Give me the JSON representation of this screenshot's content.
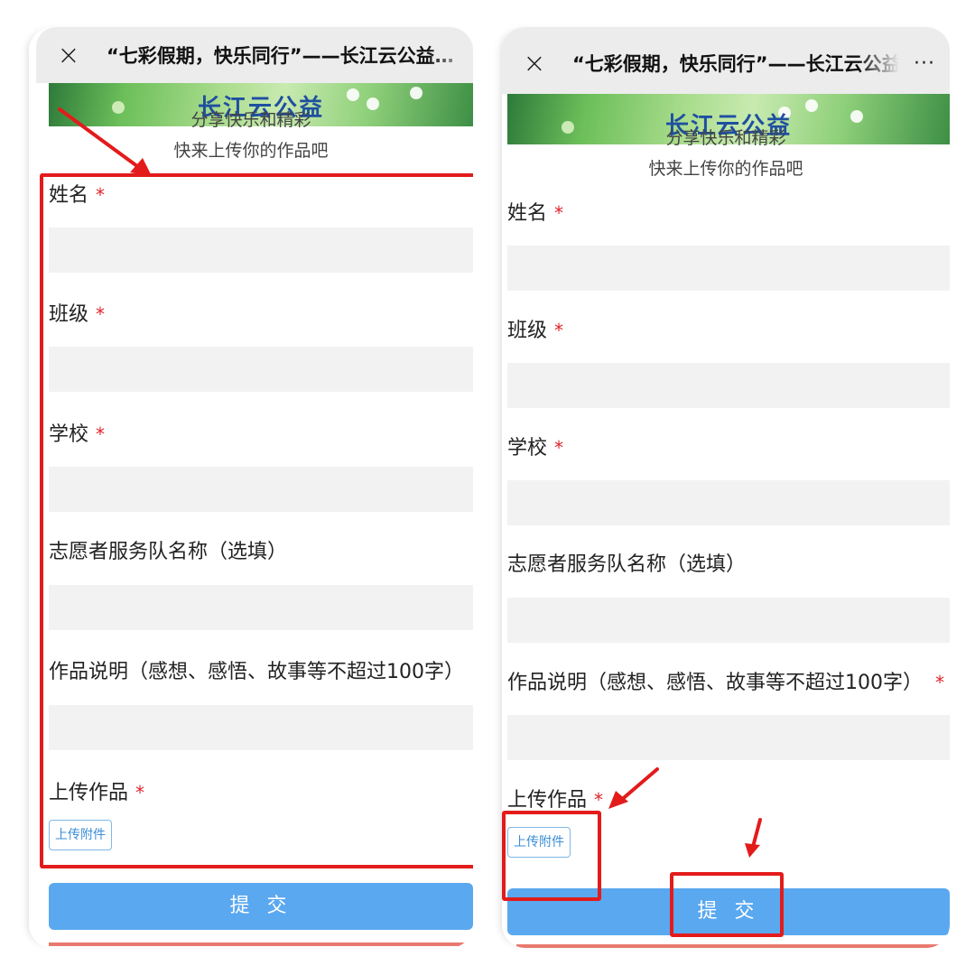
{
  "left": {
    "title": "“七彩假期，快乐同行”——长江云公益…",
    "close": "×",
    "banner_text": "长江云公益",
    "subtitle1": "分享快乐和精彩",
    "subtitle2": "快来上传你的作品吧"
  },
  "right": {
    "title": "“七彩假期，快乐同行”——长江云公益…",
    "close": "×",
    "more": "···",
    "banner_text": "长江云公益",
    "subtitle1": "分享快乐和精彩",
    "subtitle2": "快来上传你的作品吧"
  },
  "form": {
    "name_label": "姓名",
    "class_label": "班级",
    "school_label": "学校",
    "team_label": "志愿者服务队名称（选填）",
    "desc_label": "作品说明（感想、感悟、故事等不超过100字）",
    "upload_label": "上传作品",
    "required_mark": "*",
    "upload_button": "上传附件",
    "submit_button": "提 交"
  },
  "colors": {
    "submit": "#5aa8ef",
    "highlight": "#e31b1b",
    "required": "#e0242b"
  }
}
